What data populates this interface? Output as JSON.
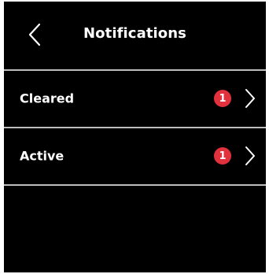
{
  "header": {
    "title": "Notifications",
    "back_icon": "chevron-left-icon"
  },
  "items": [
    {
      "label": "Cleared",
      "badge_count": "1",
      "icon": "chevron-right-icon"
    },
    {
      "label": "Active",
      "badge_count": "1",
      "icon": "chevron-right-icon"
    }
  ],
  "colors": {
    "background": "#000000",
    "text": "#ffffff",
    "divider": "#bdbdbd",
    "badge": "#e0313d"
  }
}
